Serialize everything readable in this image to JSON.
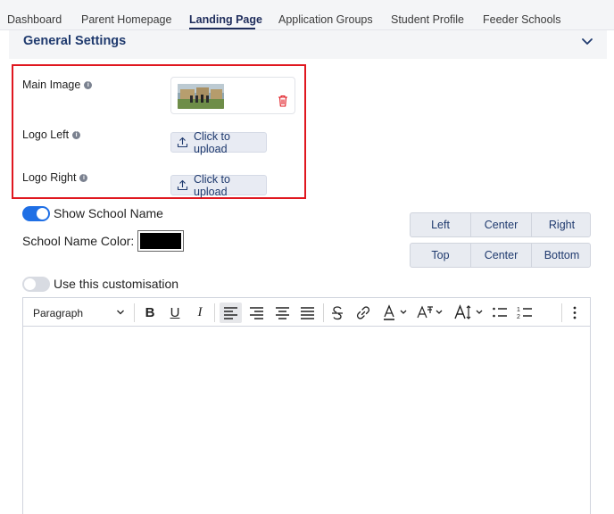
{
  "tabs": [
    {
      "label": "Dashboard"
    },
    {
      "label": "Parent Homepage"
    },
    {
      "label": "Landing Page",
      "active": true
    },
    {
      "label": "Application Groups"
    },
    {
      "label": "Student Profile"
    },
    {
      "label": "Feeder Schools"
    }
  ],
  "section": {
    "title": "General Settings",
    "expanded": true
  },
  "fields": {
    "main_image": {
      "label": "Main Image",
      "info_icon": "info-icon",
      "delete_icon": "trash-icon"
    },
    "logo_left": {
      "label": "Logo Left",
      "info_icon": "info-icon",
      "upload_label": "Click to upload"
    },
    "logo_right": {
      "label": "Logo Right",
      "info_icon": "info-icon",
      "upload_label": "Click to upload"
    }
  },
  "show_school_name": {
    "label": "Show School Name",
    "enabled": true
  },
  "school_name_color": {
    "label": "School Name Color:",
    "value": "#000000"
  },
  "horizontal_align": {
    "options": [
      "Left",
      "Center",
      "Right"
    ]
  },
  "vertical_align": {
    "options": [
      "Top",
      "Center",
      "Bottom"
    ]
  },
  "use_customisation": {
    "label": "Use this customisation",
    "enabled": false
  },
  "editor": {
    "block_format": "Paragraph",
    "tools": [
      "bold-icon",
      "underline-icon",
      "italic-icon",
      "align-left-icon",
      "align-right-icon",
      "align-center-icon",
      "align-justify-icon",
      "strikethrough-icon",
      "link-icon",
      "font-color-icon",
      "font-family-icon",
      "font-size-icon",
      "bullet-list-icon",
      "numbered-list-icon",
      "more-icon"
    ],
    "content": ""
  },
  "colors": {
    "accent": "#1f6fe5",
    "brand_text": "#1f3a6e",
    "highlight": "#e0171f",
    "delete": "#e0171f"
  }
}
